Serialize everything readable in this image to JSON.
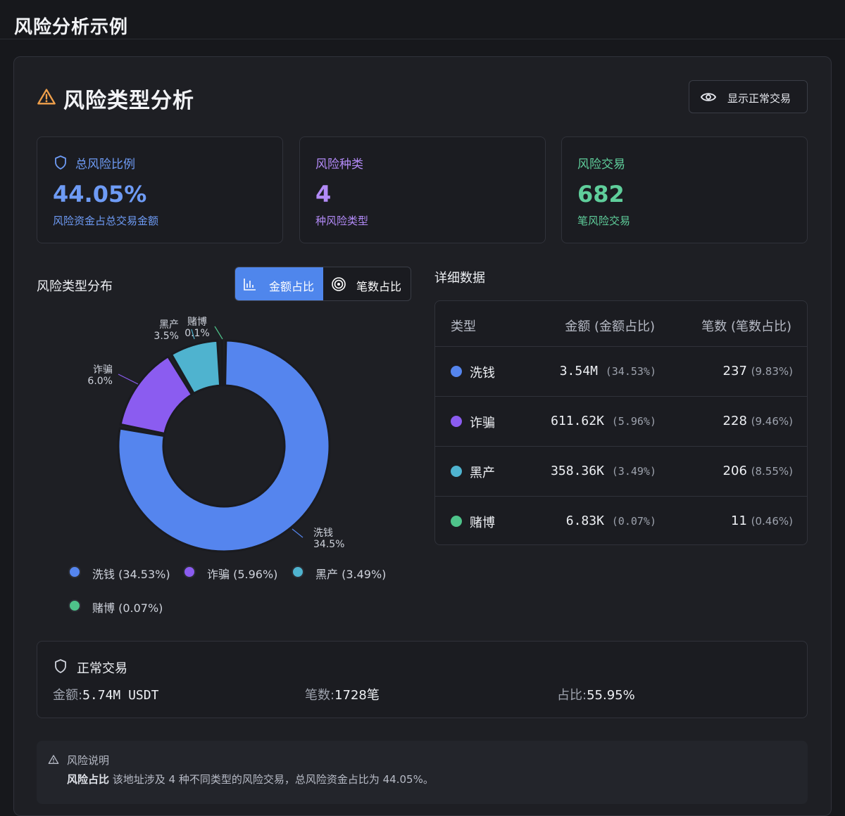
{
  "app": {
    "title": "风险分析示例"
  },
  "header": {
    "title": "风险类型分析",
    "toggle_label": "显示正常交易"
  },
  "cards": [
    {
      "title": "总风险比例",
      "value": "44.05%",
      "sub": "风险资金占总交易金额",
      "color": "#6e9bf5"
    },
    {
      "title": "风险种类",
      "value": "4",
      "sub": "种风险类型",
      "color": "#b28af7"
    },
    {
      "title": "风险交易",
      "value": "682",
      "sub": "笔风险交易",
      "color": "#5fce9b"
    }
  ],
  "distribution": {
    "title": "风险类型分布",
    "modes": [
      {
        "label": "金额占比",
        "active": true
      },
      {
        "label": "笔数占比",
        "active": false
      }
    ]
  },
  "chart_data": {
    "type": "pie",
    "variant": "donut",
    "slices": [
      {
        "name": "洗钱",
        "label_name": "洗钱",
        "label_pct": "34.5%",
        "value": 34.53,
        "color": "#5585ee"
      },
      {
        "name": "诈骗",
        "label_name": "诈骗",
        "label_pct": "6.0%",
        "value": 5.96,
        "color": "#8b5cf0"
      },
      {
        "name": "黑产",
        "label_name": "黑产",
        "label_pct": "3.5%",
        "value": 3.49,
        "color": "#4fb3cf"
      },
      {
        "name": "赌博",
        "label_name": "赌博",
        "label_pct": "0.1%",
        "value": 0.07,
        "color": "#4ec38a"
      }
    ],
    "legend": [
      "洗钱 (34.53%)",
      "诈骗 (5.96%)",
      "黑产 (3.49%)",
      "赌博 (0.07%)"
    ],
    "legend_placement": "bottom"
  },
  "details": {
    "title": "详细数据",
    "columns": [
      "类型",
      "金额 (金额占比)",
      "笔数 (笔数占比)"
    ],
    "rows": [
      {
        "name": "洗钱",
        "amount": "3.54M",
        "amount_pct": "(34.53%)",
        "count": "237",
        "count_pct": "(9.83%)",
        "color": "#5585ee"
      },
      {
        "name": "诈骗",
        "amount": "611.62K",
        "amount_pct": "(5.96%)",
        "count": "228",
        "count_pct": "(9.46%)",
        "color": "#8b5cf0"
      },
      {
        "name": "黑产",
        "amount": "358.36K",
        "amount_pct": "(3.49%)",
        "count": "206",
        "count_pct": "(8.55%)",
        "color": "#4fb3cf"
      },
      {
        "name": "赌博",
        "amount": "6.83K",
        "amount_pct": "(0.07%)",
        "count": "11",
        "count_pct": "(0.46%)",
        "color": "#4ec38a"
      }
    ]
  },
  "normal": {
    "title": "正常交易",
    "amount_label": "金额:",
    "amount_value": "5.74M USDT",
    "count_label": "笔数:",
    "count_value": "1728笔",
    "ratio_label": "占比:",
    "ratio_value": "55.95%"
  },
  "notice": {
    "title": "风险说明",
    "bold": "风险占比",
    "text": " 该地址涉及 4 种不同类型的风险交易，总风险资金占比为 44.05%。"
  }
}
